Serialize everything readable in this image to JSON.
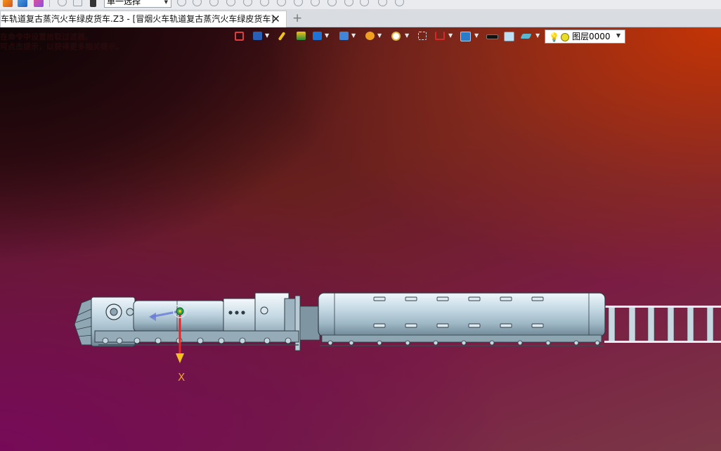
{
  "ribbon": {
    "select_mode": "单一选择"
  },
  "tabs": {
    "active_title": "车轨道复古蒸汽火车绿皮货车.Z3 - [冒烟火车轨道复古蒸汽火车绿皮货车]",
    "close_glyph": "✕",
    "add_glyph": "+"
  },
  "viewport": {
    "hint_line1": "在命令中设置拾取过滤器。",
    "hint_line2": "可点击提示，以获得更多相关提示。"
  },
  "view_toolbar": {
    "layer_label": "图层0000",
    "colors": {
      "accent_blue": "#1e73d6",
      "yellow": "#f2c21a",
      "red": "#d42a2a"
    }
  },
  "axis": {
    "x_label": "X"
  }
}
